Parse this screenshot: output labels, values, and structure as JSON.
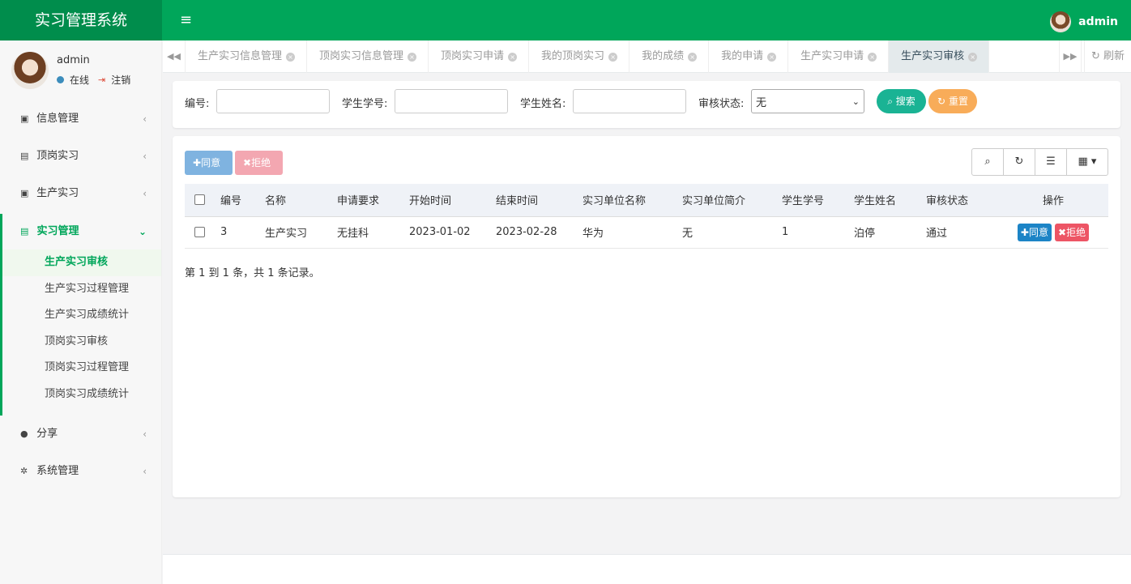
{
  "app": {
    "title": "实习管理系统",
    "menu_toggle": "≡"
  },
  "header": {
    "user": "admin"
  },
  "sidebar": {
    "user": {
      "name": "admin",
      "status": "在线",
      "logout": "注销"
    },
    "items": [
      {
        "label": "信息管理",
        "icon": "address-book-icon"
      },
      {
        "label": "顶岗实习",
        "icon": "id-card-icon"
      },
      {
        "label": "生产实习",
        "icon": "user-icon"
      },
      {
        "label": "实习管理",
        "icon": "id-card-icon"
      },
      {
        "label": "分享",
        "icon": "comment-icon"
      },
      {
        "label": "系统管理",
        "icon": "gear-icon"
      }
    ],
    "sub_items": [
      "生产实习审核",
      "生产实习过程管理",
      "生产实习成绩统计",
      "顶岗实习审核",
      "顶岗实习过程管理",
      "顶岗实习成绩统计"
    ]
  },
  "tabs": [
    "生产实习信息管理",
    "顶岗实习信息管理",
    "顶岗实习申请",
    "我的顶岗实习",
    "我的成绩",
    "我的申请",
    "生产实习申请",
    "生产实习审核"
  ],
  "tabbar": {
    "refresh": "刷新"
  },
  "search": {
    "id_label": "编号:",
    "student_no_label": "学生学号:",
    "student_name_label": "学生姓名:",
    "status_label": "审核状态:",
    "status_value": "无",
    "search_btn": "搜索",
    "reset_btn": "重置"
  },
  "toolbar": {
    "agree": "同意",
    "reject": "拒绝"
  },
  "table": {
    "headers": [
      "编号",
      "名称",
      "申请要求",
      "开始时间",
      "结束时间",
      "实习单位名称",
      "实习单位简介",
      "学生学号",
      "学生姓名",
      "审核状态",
      "操作"
    ],
    "rows": [
      {
        "cells": [
          "3",
          "生产实习",
          "无挂科",
          "2023-01-02",
          "2023-02-28",
          "华为",
          "无",
          "1",
          "泊停",
          "通过"
        ],
        "agree": "同意",
        "reject": "拒绝"
      }
    ]
  },
  "pagination": {
    "info": "第 1 到 1 条，共 1 条记录。"
  },
  "colors": {
    "brand": "#00a65a",
    "brand_dark": "#008d4c",
    "search": "#1ab394",
    "reset": "#f8ac59",
    "agree": "#1c84c6",
    "reject": "#ed5565"
  }
}
